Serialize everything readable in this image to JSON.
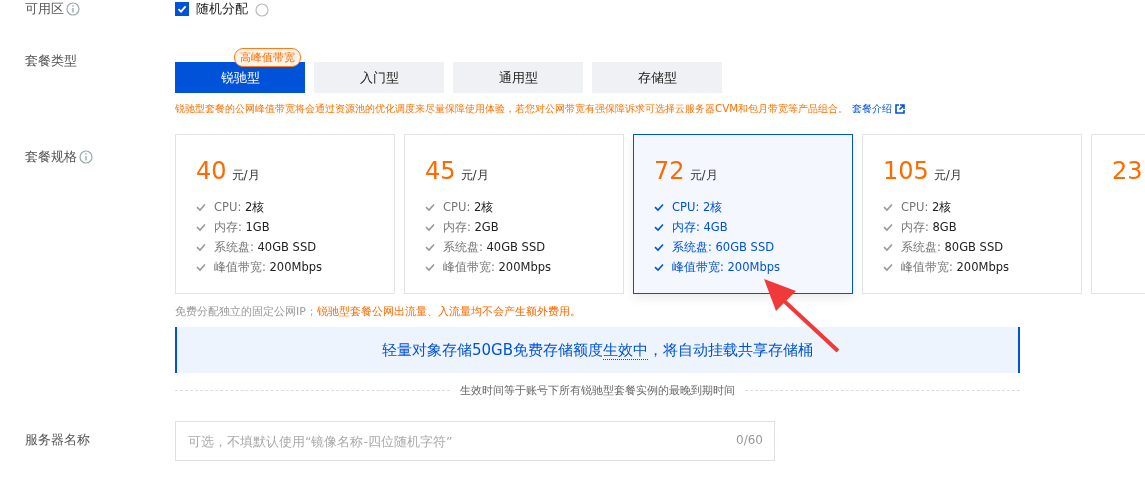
{
  "zone": {
    "label": "可用区",
    "checkbox": {
      "label": "随机分配",
      "checked": true
    }
  },
  "package_type": {
    "label": "套餐类型",
    "tabs": [
      {
        "label": "锐驰型",
        "selected": true,
        "badge": "高峰值带宽"
      },
      {
        "label": "入门型",
        "selected": false
      },
      {
        "label": "通用型",
        "selected": false
      },
      {
        "label": "存储型",
        "selected": false
      }
    ],
    "note": "锐驰型套餐的公网峰值带宽将会通过资源池的优化调度来尽量保障使用体验，若您对公网带宽有强保障诉求可选择云服务器CVM和包月带宽等产品组合。",
    "note_link": "套餐介绍"
  },
  "package_spec": {
    "label": "套餐规格",
    "cards": [
      {
        "price": "40",
        "unit": "元/月",
        "selected": false,
        "features": [
          {
            "name": "CPU:",
            "value": "2核"
          },
          {
            "name": "内存:",
            "value": "1GB"
          },
          {
            "name": "系统盘:",
            "value": "40GB SSD"
          },
          {
            "name": "峰值带宽:",
            "value": "200Mbps"
          }
        ]
      },
      {
        "price": "45",
        "unit": "元/月",
        "selected": false,
        "features": [
          {
            "name": "CPU:",
            "value": "2核"
          },
          {
            "name": "内存:",
            "value": "2GB"
          },
          {
            "name": "系统盘:",
            "value": "40GB SSD"
          },
          {
            "name": "峰值带宽:",
            "value": "200Mbps"
          }
        ]
      },
      {
        "price": "72",
        "unit": "元/月",
        "selected": true,
        "features": [
          {
            "name": "CPU:",
            "value": "2核"
          },
          {
            "name": "内存:",
            "value": "4GB"
          },
          {
            "name": "系统盘:",
            "value": "60GB SSD"
          },
          {
            "name": "峰值带宽:",
            "value": "200Mbps"
          }
        ]
      },
      {
        "price": "105",
        "unit": "元/月",
        "selected": false,
        "features": [
          {
            "name": "CPU:",
            "value": "2核"
          },
          {
            "name": "内存:",
            "value": "8GB"
          },
          {
            "name": "系统盘:",
            "value": "80GB SSD"
          },
          {
            "name": "峰值带宽:",
            "value": "200Mbps"
          }
        ]
      },
      {
        "price": "23",
        "selected": false
      }
    ],
    "note_grey": "免费分配独立的固定公网IP；",
    "note_orange": "锐驰型套餐公网出流量、入流量均不会产生额外费用。",
    "banner_before": "轻量对象存储50GB免费存储额度",
    "banner_underlined": "生效中",
    "banner_after": "，将自动挂载共享存储桶",
    "divider_text": "生效时间等于账号下所有锐驰型套餐实例的最晚到期时间"
  },
  "server_name": {
    "label": "服务器名称",
    "placeholder": "可选，不填默认使用“镜像名称-四位随机字符”",
    "counter": "0/60"
  }
}
